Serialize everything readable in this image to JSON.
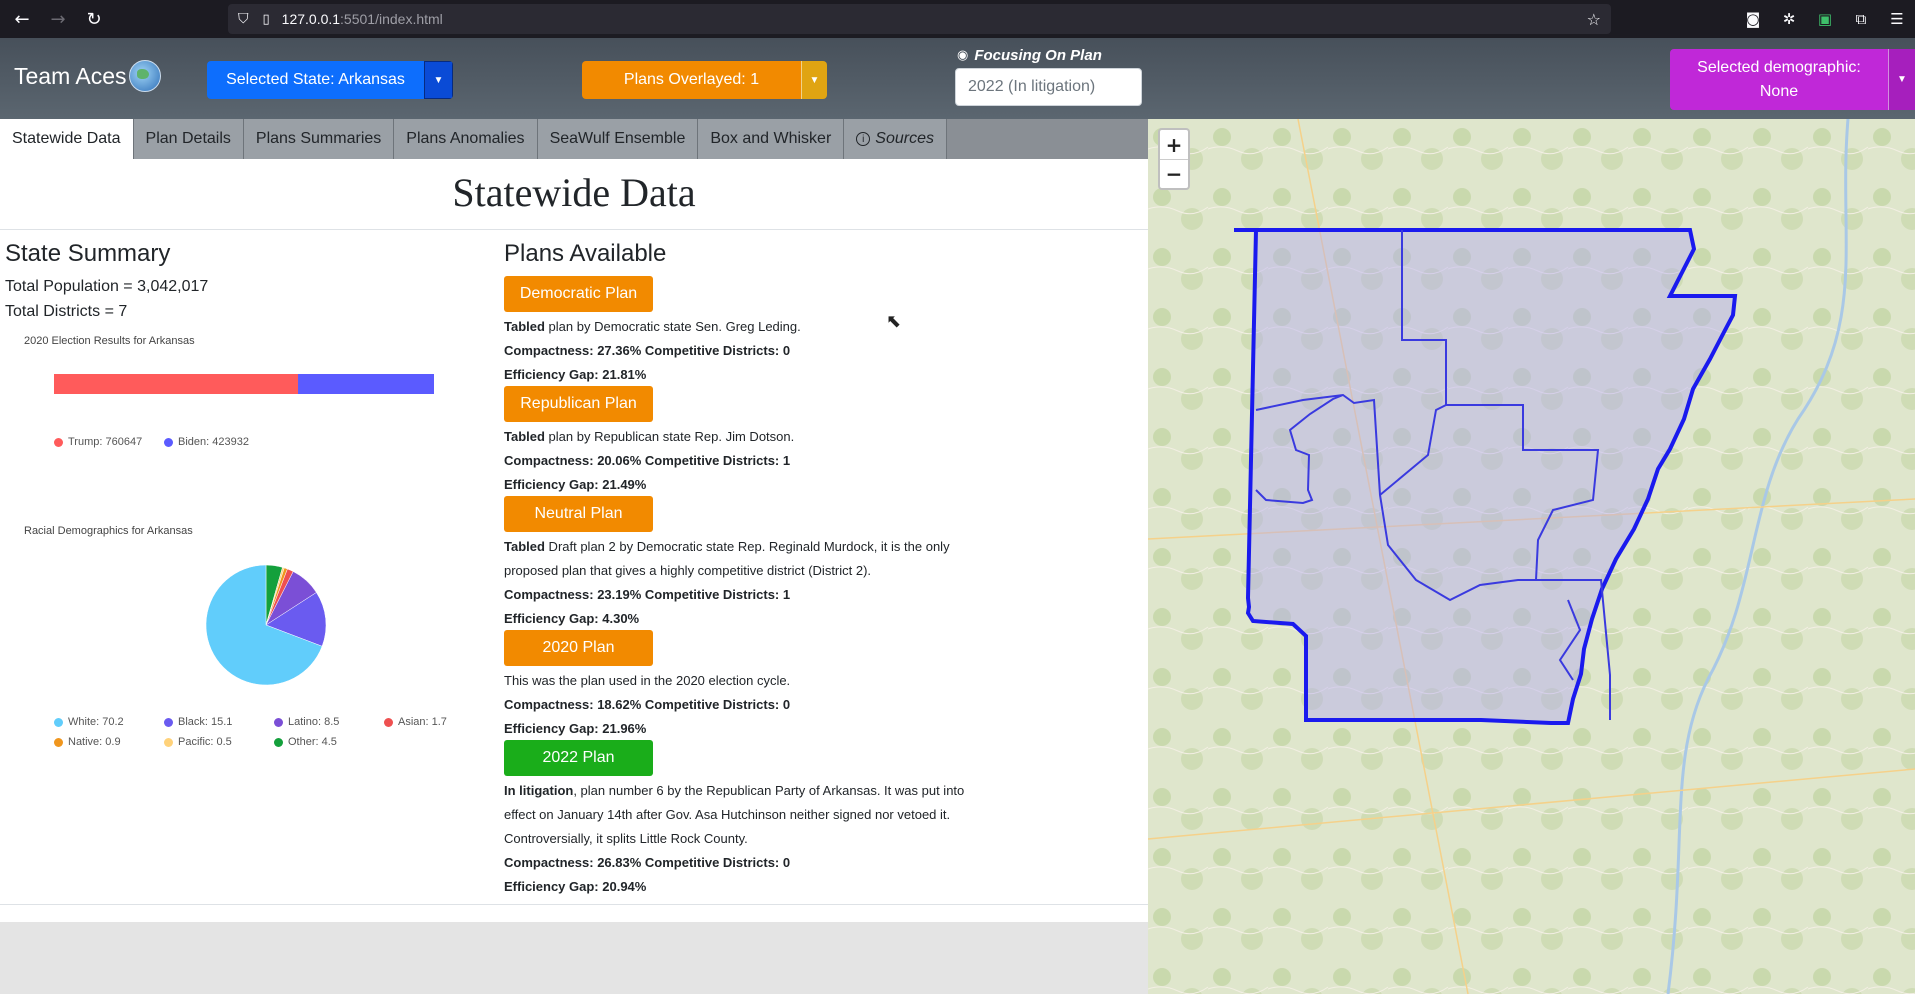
{
  "browser": {
    "url_host": "127.0.0.1",
    "url_rest": ":5501/index.html"
  },
  "header": {
    "brand": "Team Aces",
    "state_button": "Selected State: Arkansas",
    "plans_button": "Plans Overlayed: 1",
    "focus_label": "Focusing On Plan",
    "focus_value": "2022 (In litigation)",
    "demographic_button": "Selected demographic: None"
  },
  "tabs": [
    {
      "label": "Statewide Data",
      "active": true
    },
    {
      "label": "Plan Details"
    },
    {
      "label": "Plans Summaries"
    },
    {
      "label": "Plans Anomalies"
    },
    {
      "label": "SeaWulf Ensemble"
    },
    {
      "label": "Box and Whisker"
    },
    {
      "label": "Sources"
    }
  ],
  "main": {
    "title": "Statewide Data",
    "state_summary": {
      "heading": "State Summary",
      "total_population": "Total Population = 3,042,017",
      "total_districts": "Total Districts = 7"
    },
    "election_chart": {
      "caption": "2020 Election Results for Arkansas",
      "legend": [
        {
          "label": "Trump: 760647",
          "color": "#ff5b5b",
          "value": 760647
        },
        {
          "label": "Biden: 423932",
          "color": "#5b5bff",
          "value": 423932
        }
      ]
    },
    "race_chart": {
      "caption": "Racial Demographics for Arkansas",
      "legend": [
        {
          "label": "White: 70.2",
          "color": "#61cdfb",
          "value": 70.2
        },
        {
          "label": "Black: 15.1",
          "color": "#6a5bf0",
          "value": 15.1
        },
        {
          "label": "Latino: 8.5",
          "color": "#7b4fd6",
          "value": 8.5
        },
        {
          "label": "Asian: 1.7",
          "color": "#ee5050",
          "value": 1.7
        },
        {
          "label": "Native: 0.9",
          "color": "#f0961e",
          "value": 0.9
        },
        {
          "label": "Pacific: 0.5",
          "color": "#ffd27a",
          "value": 0.5
        },
        {
          "label": "Other: 4.5",
          "color": "#14a03c",
          "value": 4.5
        }
      ]
    },
    "plans": {
      "heading": "Plans Available",
      "items": [
        {
          "button": "Democratic Plan",
          "color": "#f28a00",
          "desc_bold": "Tabled",
          "desc": " plan by Democratic state Sen. Greg Leding.",
          "compactness": "Compactness: 27.36% Competitive Districts: 0",
          "efficiency": "Efficiency Gap: 21.81%"
        },
        {
          "button": "Republican Plan",
          "color": "#f28a00",
          "desc_bold": "Tabled",
          "desc": " plan by Republican state Rep. Jim Dotson.",
          "compactness": "Compactness: 20.06% Competitive Districts: 1",
          "efficiency": "Efficiency Gap: 21.49%"
        },
        {
          "button": "Neutral Plan",
          "color": "#f28a00",
          "desc_bold": "Tabled",
          "desc": " Draft plan 2 by Democratic state Rep. Reginald Murdock, it is the only proposed plan that gives a highly competitive district (District 2).",
          "compactness": "Compactness: 23.19% Competitive Districts: 1",
          "efficiency": "Efficiency Gap: 4.30%"
        },
        {
          "button": "2020 Plan",
          "color": "#f28a00",
          "desc_bold": "",
          "desc": "This was the plan used in the 2020 election cycle.",
          "compactness": "Compactness: 18.62% Competitive Districts: 0",
          "efficiency": "Efficiency Gap: 21.96%"
        },
        {
          "button": "2022 Plan",
          "color": "#1aad1a",
          "desc_bold": "In litigation",
          "desc": ", plan number 6 by the Republican Party of Arkansas. It was put into effect on January 14th after Gov. Asa Hutchinson neither signed nor vetoed it. Controversially, it splits Little Rock County.",
          "compactness": "Compactness: 26.83% Competitive Districts: 0",
          "efficiency": "Efficiency Gap: 20.94%"
        }
      ]
    }
  },
  "map": {
    "zoom_in": "+",
    "zoom_out": "−"
  }
}
